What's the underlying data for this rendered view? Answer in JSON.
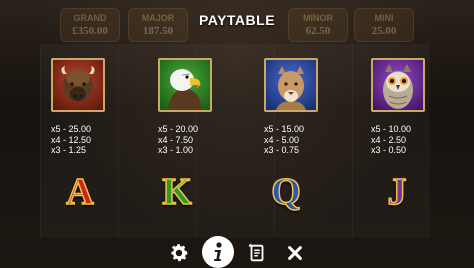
{
  "header": {
    "title": "PAYTABLE"
  },
  "background": {
    "jackpots": [
      {
        "label": "GRAND",
        "value": "£350.00"
      },
      {
        "label": "MAJOR",
        "value": "187.50"
      },
      {
        "label": "MINOR",
        "value": "62.50"
      },
      {
        "label": "MINI",
        "value": "25.00"
      }
    ]
  },
  "symbols": [
    {
      "icon": "bison-icon",
      "lines": [
        "x5 - 25.00",
        "x4 - 12.50",
        "x3 - 1.25"
      ],
      "frame_color": "#8a2a1a"
    },
    {
      "icon": "eagle-icon",
      "lines": [
        "x5 - 20.00",
        "x4 - 7.50",
        "x3 - 1.00"
      ],
      "frame_color": "#2e7a2a"
    },
    {
      "icon": "cougar-icon",
      "lines": [
        "x5 - 15.00",
        "x4 - 5.00",
        "x3 - 0.75"
      ],
      "frame_color": "#2a4a9a"
    },
    {
      "icon": "owl-icon",
      "lines": [
        "x5 - 10.00",
        "x4 - 2.50",
        "x3 - 0.50"
      ],
      "frame_color": "#6a2a8a"
    }
  ],
  "cards": [
    {
      "letter": "A",
      "color": "#c9251c"
    },
    {
      "letter": "K",
      "color": "#2f9a2a"
    },
    {
      "letter": "Q",
      "color": "#2b55b8"
    },
    {
      "letter": "J",
      "color": "#7a2e9a"
    }
  ],
  "toolbar": {
    "items": [
      {
        "icon": "gear-icon"
      },
      {
        "icon": "info-icon",
        "active": true
      },
      {
        "icon": "scroll-icon"
      },
      {
        "icon": "close-icon"
      }
    ]
  }
}
